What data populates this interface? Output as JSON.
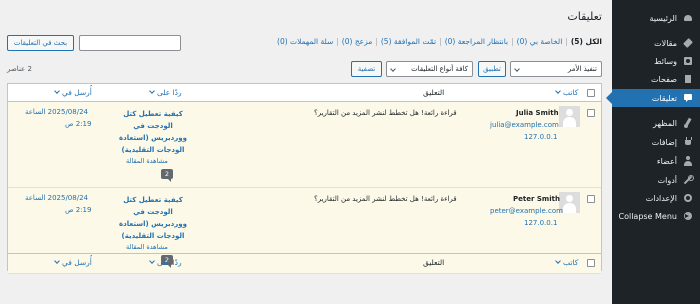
{
  "sidebar": {
    "items": [
      {
        "label": "الرئيسية",
        "icon": "dashboard-icon"
      },
      {
        "label": "مقالات",
        "icon": "pin-icon"
      },
      {
        "label": "وسائط",
        "icon": "media-icon"
      },
      {
        "label": "صفحات",
        "icon": "page-icon"
      },
      {
        "label": "تعليقات",
        "icon": "comments-icon"
      },
      {
        "label": "المظهر",
        "icon": "brush-icon"
      },
      {
        "label": "إضافات",
        "icon": "plugin-icon"
      },
      {
        "label": "أعضاء",
        "icon": "users-icon"
      },
      {
        "label": "أدوات",
        "icon": "tools-icon"
      },
      {
        "label": "الإعدادات",
        "icon": "settings-icon"
      },
      {
        "label": "Collapse Menu",
        "icon": "collapse-icon"
      }
    ],
    "accent": "#2271b1"
  },
  "page": {
    "title": "تعليقات"
  },
  "filters": [
    {
      "label": "الكل",
      "count": "(5)"
    },
    {
      "label": "الخاصة بي",
      "count": "(0)"
    },
    {
      "label": "بانتظار المراجعة",
      "count": "(0)"
    },
    {
      "label": "تمّت الموافقة",
      "count": "(5)"
    },
    {
      "label": "مزعج",
      "count": "(0)"
    },
    {
      "label": "سلة المهملات",
      "count": "(0)"
    }
  ],
  "search": {
    "button_label": "بحث في التعليقات",
    "value": ""
  },
  "toolbar": {
    "bulk_action": "تنفيذ الأمر",
    "apply_label": "تطبيق",
    "comment_type": "كافة أنواع التعليقات",
    "filter_label": "تصفية",
    "items_count": "2 عناصر"
  },
  "table": {
    "headers": {
      "author": "كاتب",
      "comment": "التعليق",
      "response": "ردًا على",
      "date": "أُرسل في"
    },
    "rows": [
      {
        "author_name": "Julia Smith",
        "author_email": "julia@example.com",
        "author_ip": "127.0.0.1",
        "comment": "قراءة رائعة! هل تخطط لنشر المزيد من التقارير؟",
        "response_title": "كيفية تعطيل كتل الودجت في ووردبريس (استعادة الودجات التقليدية)",
        "view_post": "مشاهدة المقالة",
        "comment_count": "2",
        "date": "2025/08/24 الساعة",
        "time": "2:19 ص"
      },
      {
        "author_name": "Peter Smith",
        "author_email": "peter@example.com",
        "author_ip": "127.0.0.1",
        "comment": "قراءة رائعة! هل تخطط لنشر المزيد من التقارير؟",
        "response_title": "كيفية تعطيل كتل الودجت في ووردبريس (استعادة الودجات التقليدية)",
        "view_post": "مشاهدة المقالة",
        "comment_count": "2",
        "date": "2025/08/24 الساعة",
        "time": "2:19 ص"
      }
    ]
  }
}
